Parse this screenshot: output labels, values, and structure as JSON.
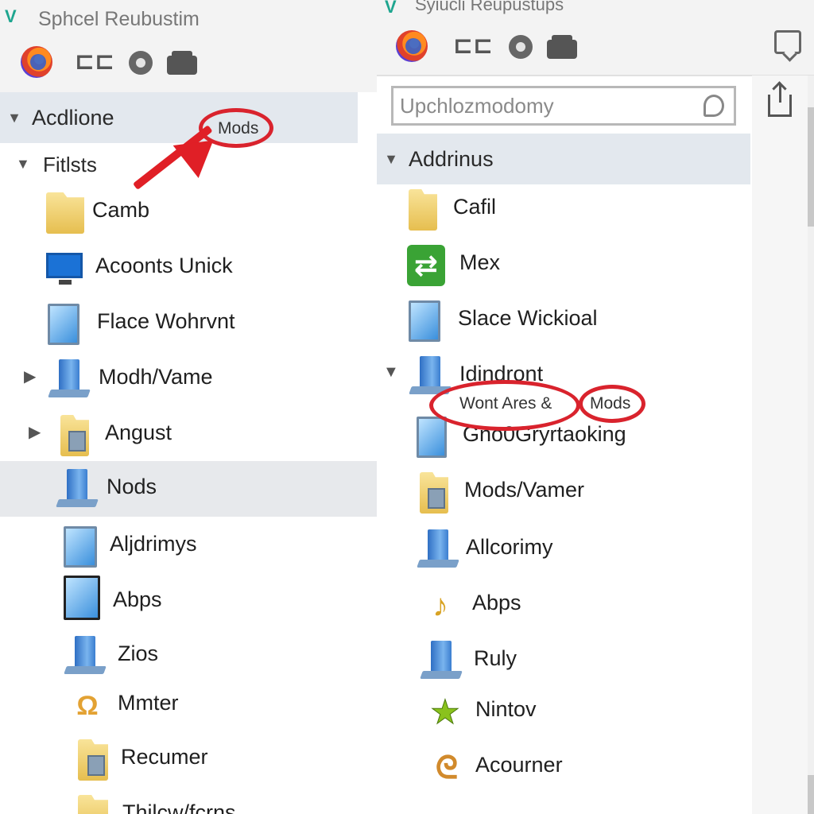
{
  "left": {
    "title": "Sphcel Reubustim",
    "header": "Acdlione",
    "group": "Fitlsts",
    "items": [
      {
        "label": "Camb",
        "icon": "folder-icon"
      },
      {
        "label": "Acoonts Unick",
        "icon": "monitor-icon"
      },
      {
        "label": "Flace Wohrvnt",
        "icon": "window-icon"
      },
      {
        "label": "Modh/Vame",
        "icon": "server-icon"
      },
      {
        "label": "Angust",
        "icon": "folder-doc-icon"
      },
      {
        "label": "Nods",
        "icon": "server-icon",
        "selected": true
      },
      {
        "label": "Aljdrimys",
        "icon": "window-icon"
      },
      {
        "label": "Abps",
        "icon": "window-icon"
      },
      {
        "label": "Zios",
        "icon": "server-icon"
      },
      {
        "label": "Mmter",
        "icon": "key-icon"
      },
      {
        "label": "Recumer",
        "icon": "folder-doc-icon"
      },
      {
        "label": "Thilcw/fcrns",
        "icon": "folder-icon"
      }
    ],
    "annotation": "Mods"
  },
  "right": {
    "title": "Syiucli Reupustups",
    "search_placeholder": "Upchlozmodomy",
    "header": "Addrinus",
    "items": [
      {
        "label": "Cafil",
        "icon": "folder-icon"
      },
      {
        "label": "Mex",
        "icon": "green-arrows-icon"
      },
      {
        "label": "Slace Wickioal",
        "icon": "window-icon"
      },
      {
        "label": "Idindront",
        "icon": "server-icon"
      },
      {
        "label": "Gno0Gryrtaoking",
        "icon": "window-icon"
      },
      {
        "label": "Mods/Vamer",
        "icon": "folder-doc-icon"
      },
      {
        "label": "Allcorimy",
        "icon": "server-icon"
      },
      {
        "label": "Abps",
        "icon": "music-icon"
      },
      {
        "label": "Ruly",
        "icon": "server-icon"
      },
      {
        "label": "Nintov",
        "icon": "star-icon"
      },
      {
        "label": "Acourner",
        "icon": "wrench-icon"
      }
    ],
    "annotation_a": "Wont Ares &",
    "annotation_b": "Mods"
  },
  "colors": {
    "annotation_red": "#d9232d",
    "header_bg": "#e3e8ee",
    "selected_bg": "#e7e9ec"
  }
}
